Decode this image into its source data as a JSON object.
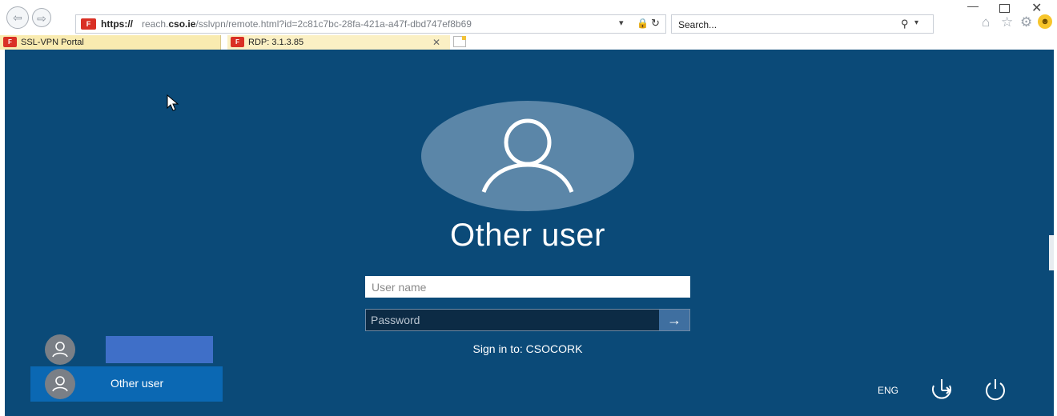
{
  "browser": {
    "url_protocol": "https://",
    "url_host_pre": "reach.",
    "url_host_bold": "cso.ie",
    "url_path": "/sslvpn/remote.html?id=2c81c7bc-28fa-421a-a47f-dbd747ef8b69",
    "search_placeholder": "Search...",
    "tabs": [
      {
        "label": "SSL-VPN Portal"
      },
      {
        "label": "RDP: 3.1.3.85"
      }
    ],
    "icons": {
      "back": "back-arrow-icon",
      "forward": "forward-arrow-icon",
      "lock": "lock-icon",
      "refresh": "refresh-icon",
      "search": "search-icon",
      "home": "home-icon",
      "favorites": "star-icon",
      "settings": "gear-icon",
      "feedback": "smiley-icon"
    }
  },
  "lock_screen": {
    "title": "Other user",
    "username_placeholder": "User name",
    "password_placeholder": "Password",
    "sign_in_text": "Sign in to: CSOCORK",
    "users": [
      {
        "label": ""
      },
      {
        "label": "Other user"
      }
    ],
    "language": "ENG",
    "colors": {
      "background": "#0b4a78",
      "avatar_circle": "#5b86a8",
      "selected_tile": "#0b68b3",
      "submit_button": "#3f6fa0"
    }
  }
}
